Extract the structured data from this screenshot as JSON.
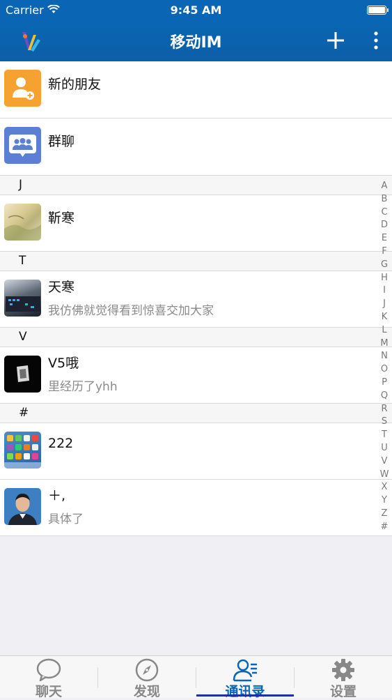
{
  "status": {
    "carrier": "Carrier",
    "time": "9:45 AM"
  },
  "nav": {
    "title": "移动IM"
  },
  "special": [
    {
      "name": "新的朋友",
      "icon": "add-friend-icon",
      "color": "#f5a231"
    },
    {
      "name": "群聊",
      "icon": "group-chat-icon",
      "color": "#5b7fd3"
    }
  ],
  "sections": [
    {
      "letter": "J",
      "contacts": [
        {
          "name": "靳寒",
          "status": ""
        }
      ]
    },
    {
      "letter": "T",
      "contacts": [
        {
          "name": "天寒",
          "status": "我仿佛就觉得看到惊喜交加大家"
        }
      ]
    },
    {
      "letter": "V",
      "contacts": [
        {
          "name": "V5哦",
          "status": "里经历了yhh"
        }
      ]
    },
    {
      "letter": "#",
      "contacts": [
        {
          "name": "222",
          "status": ""
        },
        {
          "name": "＋,",
          "status": "具体了"
        }
      ]
    }
  ],
  "index_letters": [
    "A",
    "B",
    "C",
    "D",
    "E",
    "F",
    "G",
    "H",
    "I",
    "J",
    "K",
    "L",
    "M",
    "N",
    "O",
    "P",
    "Q",
    "R",
    "S",
    "T",
    "U",
    "V",
    "W",
    "X",
    "Y",
    "Z",
    "#"
  ],
  "tabs": [
    {
      "label": "聊天",
      "icon": "chat-bubble-icon",
      "active": false
    },
    {
      "label": "发现",
      "icon": "compass-icon",
      "active": false
    },
    {
      "label": "通讯录",
      "icon": "contacts-icon",
      "active": true
    },
    {
      "label": "设置",
      "icon": "gear-icon",
      "active": false
    }
  ],
  "colors": {
    "primary": "#0a66b4",
    "active_tab": "#0a66b4",
    "inactive_tab": "#888888"
  }
}
